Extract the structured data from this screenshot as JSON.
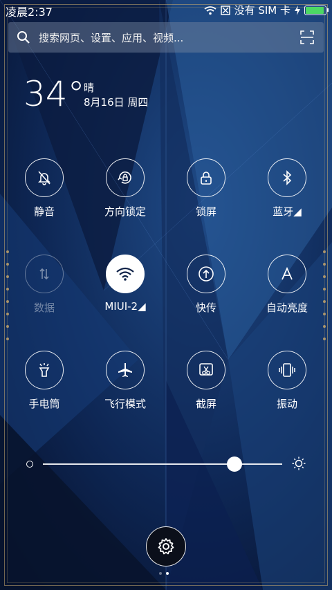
{
  "status": {
    "time": "凌晨2:37",
    "sim": "没有 SIM 卡",
    "battery_level": 1.0,
    "battery_color": "#4cd964"
  },
  "search": {
    "placeholder": "搜索网页、设置、应用、视频...",
    "icon": "search-icon",
    "scan_icon": "scan-icon"
  },
  "weather": {
    "temperature": "34°",
    "condition": "晴",
    "date": "8月16日 周四"
  },
  "toggles": [
    {
      "label": "静音",
      "icon": "bell-off-icon",
      "state": "off"
    },
    {
      "label": "方向锁定",
      "icon": "rotation-lock-icon",
      "state": "off"
    },
    {
      "label": "锁屏",
      "icon": "lock-icon",
      "state": "off"
    },
    {
      "label": "蓝牙◢",
      "icon": "bluetooth-icon",
      "state": "off"
    },
    {
      "label": "数据",
      "icon": "data-icon",
      "state": "disabled"
    },
    {
      "label": "MIUI-2◢",
      "icon": "wifi-icon",
      "state": "on"
    },
    {
      "label": "快传",
      "icon": "quick-share-icon",
      "state": "off"
    },
    {
      "label": "自动亮度",
      "icon": "auto-brightness-icon",
      "state": "off"
    },
    {
      "label": "手电筒",
      "icon": "flashlight-icon",
      "state": "off"
    },
    {
      "label": "飞行模式",
      "icon": "airplane-icon",
      "state": "off"
    },
    {
      "label": "截屏",
      "icon": "screenshot-icon",
      "state": "off"
    },
    {
      "label": "振动",
      "icon": "vibrate-icon",
      "state": "off"
    }
  ],
  "brightness": {
    "level": 0.8
  },
  "settings": {
    "icon": "gear-icon"
  },
  "pager": {
    "pages": 2,
    "current": 2
  },
  "colors": {
    "accent": "#ffffff",
    "frame": "#c9a86a",
    "background": "#0a1a3a"
  }
}
